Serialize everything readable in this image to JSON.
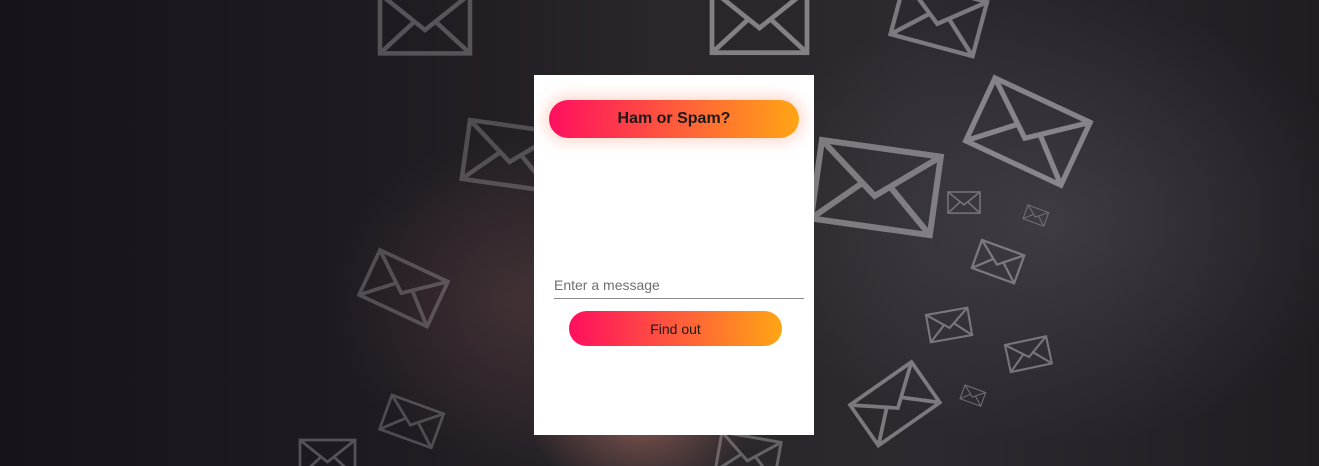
{
  "header": {
    "title": "Ham or Spam?"
  },
  "form": {
    "message_placeholder": "Enter a message",
    "message_value": "",
    "submit_label": "Find out"
  },
  "theme": {
    "gradient_start": "#ff0f5f",
    "gradient_mid": "#ff5a3c",
    "gradient_end": "#ffa514",
    "card_background": "#ffffff",
    "page_background": "#1e1b22"
  },
  "background": {
    "decoration_icon": "envelope-icon"
  }
}
